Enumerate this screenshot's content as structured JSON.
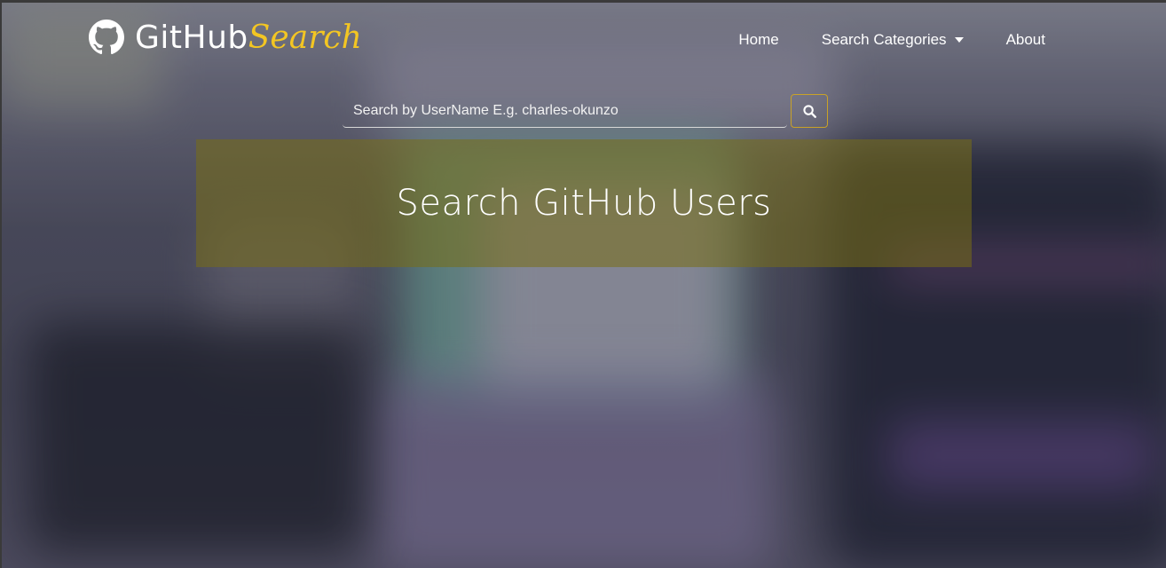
{
  "brand": {
    "name_part1": "GitHub",
    "name_part2": "Search",
    "icon": "github-icon",
    "accent_color": "#f3c623"
  },
  "nav": {
    "items": [
      {
        "label": "Home"
      },
      {
        "label": "Search Categories",
        "has_dropdown": true
      },
      {
        "label": "About"
      }
    ]
  },
  "search": {
    "placeholder": "Search by UserName E.g. charles-okunzo",
    "value": "",
    "button_icon": "search-icon"
  },
  "hero": {
    "title": "Search GitHub Users"
  }
}
